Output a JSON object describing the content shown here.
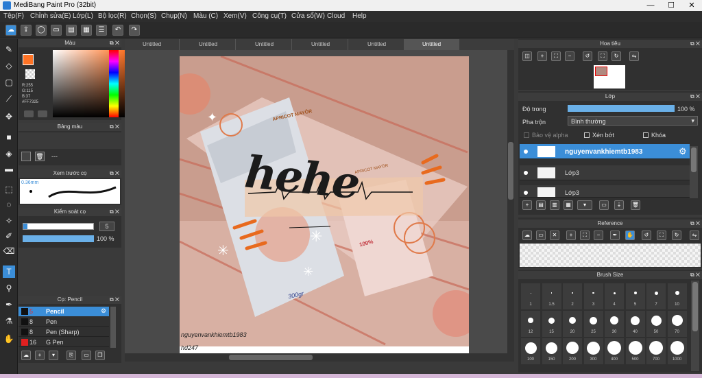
{
  "window": {
    "title": "MediBang Paint Pro (32bit)",
    "minimize": "—",
    "maximize": "☐",
    "close": "✕"
  },
  "menu": [
    "Tệp(F)",
    "Chỉnh sửa(E)",
    "Lớp(L)",
    "Bộ lọc(R)",
    "Chọn(S)",
    "Chụp(N)",
    "Màu (C)",
    "Xem(V)",
    "Công cụ(T)",
    "Cửa sổ(W)",
    "Cloud",
    "Help"
  ],
  "tabs": [
    "Untitled",
    "Untitled",
    "Untitled",
    "Untitled",
    "Untitled",
    "Untitled"
  ],
  "color_panel": {
    "title": "Màu",
    "r": "R:255",
    "g": "G:115",
    "b": "B:37",
    "hex": "#FF7325",
    "fg": "#FF7325"
  },
  "swatch_panel": {
    "title": "Bảng màu",
    "value": "---"
  },
  "preview_panel": {
    "title": "Xem trước cọ",
    "size": "0.36mm"
  },
  "brush_control": {
    "title": "Kiểm soát cọ",
    "size": "5",
    "opacity": "100 %",
    "opacity_pct": 100
  },
  "brush_panel": {
    "title": "Cọ: Pencil",
    "items": [
      {
        "num": "5",
        "name": "Pencil",
        "color": "#111111"
      },
      {
        "num": "8",
        "name": "Pen",
        "color": "#111111"
      },
      {
        "num": "8",
        "name": "Pen (Sharp)",
        "color": "#111111"
      },
      {
        "num": "16",
        "name": "G Pen",
        "color": "#e02020"
      }
    ]
  },
  "navigator": {
    "title": "Hoa tiêu"
  },
  "layer_panel": {
    "title": "Lớp",
    "opacity_label": "Độ trong",
    "opacity_value": "100 %",
    "opacity_pct": 100,
    "blend_label": "Pha trộn",
    "blend_value": "Bình thường",
    "protect_alpha": "Bảo vệ alpha",
    "clip": "Xén bớt",
    "lock": "Khóa",
    "layers": [
      "nguyenvankhiemtb1983",
      "Lớp3",
      "Lớp3"
    ]
  },
  "reference": {
    "title": "Reference"
  },
  "brush_size": {
    "title": "Brush Size",
    "sizes": [
      "1",
      "1.5",
      "2",
      "3",
      "4",
      "5",
      "7",
      "10",
      "12",
      "15",
      "20",
      "25",
      "30",
      "40",
      "50",
      "70",
      "100",
      "150",
      "200",
      "300",
      "400",
      "500",
      "700",
      "1000"
    ]
  },
  "artwork": {
    "brand": "APRICOT MAYÔR",
    "brand2": "APRICOT MAYÔR",
    "weight": "300gr",
    "percent": "100%",
    "sign1": "nguyenvankhiemtb1983",
    "sign2": "hd247",
    "headline": "hehe"
  }
}
